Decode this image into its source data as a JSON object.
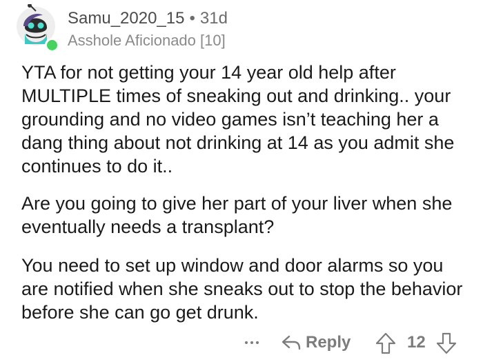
{
  "comment": {
    "author": {
      "username": "Samu_2020_15",
      "separator": "•",
      "age": "31d",
      "flair": "Asshole Aficionado [10]",
      "avatar_icon": "snoo-avatar-icon",
      "online": true,
      "online_color": "#46d160"
    },
    "paragraphs": [
      "YTA for not getting your 14 year old help after MULTIPLE times of sneaking out and drinking.. your grounding and no video games isn’t teaching her a dang thing about not drinking at 14 as you admit she continues to do it..",
      "Are you going to give her part of your liver when she eventually needs a transplant?",
      "You need to set up window and door alarms so you are notified when she sneaks out to stop the behavior before she can go get drunk."
    ],
    "actions": {
      "more_icon": "more-options-icon",
      "reply_icon": "reply-arrow-icon",
      "reply_label": "Reply",
      "upvote_icon": "upvote-arrow-icon",
      "score": "12",
      "downvote_icon": "downvote-arrow-icon"
    }
  }
}
